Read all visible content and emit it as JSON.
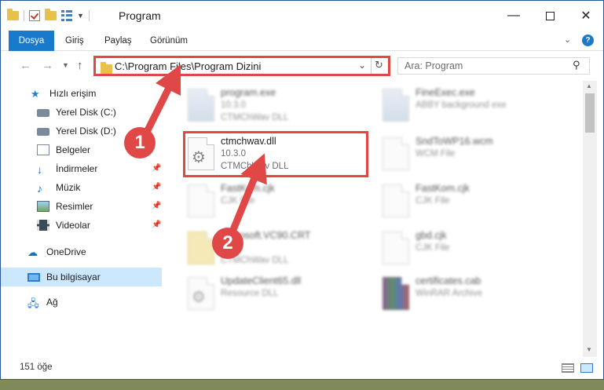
{
  "titlebar": {
    "title": "Program",
    "minimize": "—",
    "close": "✕"
  },
  "ribbon": {
    "file_tab": "Dosya",
    "tabs": [
      "Giriş",
      "Paylaş",
      "Görünüm"
    ],
    "help": "?"
  },
  "address": {
    "path": "C:\\Program Files\\Program Dizini",
    "search_placeholder": "Ara: Program"
  },
  "navpane": {
    "items": [
      {
        "label": "Hızlı erişim",
        "icon": "star-icon",
        "pinned": false
      },
      {
        "label": "Yerel Disk (C:)",
        "icon": "disk-icon",
        "pinned": false
      },
      {
        "label": "Yerel Disk (D:)",
        "icon": "disk-icon",
        "pinned": false
      },
      {
        "label": "Belgeler",
        "icon": "documents-icon",
        "pinned": false
      },
      {
        "label": "İndirmeler",
        "icon": "download-icon",
        "pinned": true
      },
      {
        "label": "Müzik",
        "icon": "music-icon",
        "pinned": true
      },
      {
        "label": "Resimler",
        "icon": "pictures-icon",
        "pinned": true
      },
      {
        "label": "Videolar",
        "icon": "videos-icon",
        "pinned": true
      },
      {
        "label": "OneDrive",
        "icon": "cloud-icon",
        "pinned": false
      },
      {
        "label": "Bu bilgisayar",
        "icon": "computer-icon",
        "pinned": false,
        "selected": true
      },
      {
        "label": "Ağ",
        "icon": "network-icon",
        "pinned": false
      }
    ]
  },
  "files": [
    {
      "name": "program.exe",
      "line1": "10.3.0",
      "line2": "CTMChWav DLL",
      "icon": "exe-icon",
      "blurred": true
    },
    {
      "name": "FineExec.exe",
      "line1": "ABBY background exe",
      "line2": "",
      "icon": "exe-icon",
      "blurred": true
    },
    {
      "name": "ctmchwav.dll",
      "line1": "10.3.0",
      "line2": "CTMChWav DLL",
      "icon": "dll-gear-icon",
      "blurred": false
    },
    {
      "name": "SndToWP16.wcm",
      "line1": "WCM File",
      "line2": "",
      "icon": "file-icon",
      "blurred": true
    },
    {
      "name": "FastKom.cjk",
      "line1": "CJK File",
      "line2": "",
      "icon": "file-icon",
      "blurred": true
    },
    {
      "name": "FastKom.cjk",
      "line1": "CJK File",
      "line2": "",
      "icon": "file-icon",
      "blurred": true
    },
    {
      "name": "Microsoft.VC90.CRT",
      "line1": "",
      "line2": "CTMChWav DLL",
      "icon": "folder-icon",
      "blurred": true
    },
    {
      "name": "gbd.cjk",
      "line1": "CJK File",
      "line2": "",
      "icon": "file-icon",
      "blurred": true
    },
    {
      "name": "UpdateClient65.dll",
      "line1": "Resource DLL",
      "line2": "",
      "icon": "dll-gear-icon",
      "blurred": true
    },
    {
      "name": "certificates.cab",
      "line1": "WinRAR Archive",
      "line2": "",
      "icon": "archive-icon",
      "blurred": true
    }
  ],
  "status": {
    "count": "151 öğe"
  },
  "annotations": {
    "step1": "1",
    "step2": "2",
    "color": "#e04848"
  },
  "colors": {
    "accent": "#1979ca",
    "selection": "#cce8ff"
  }
}
